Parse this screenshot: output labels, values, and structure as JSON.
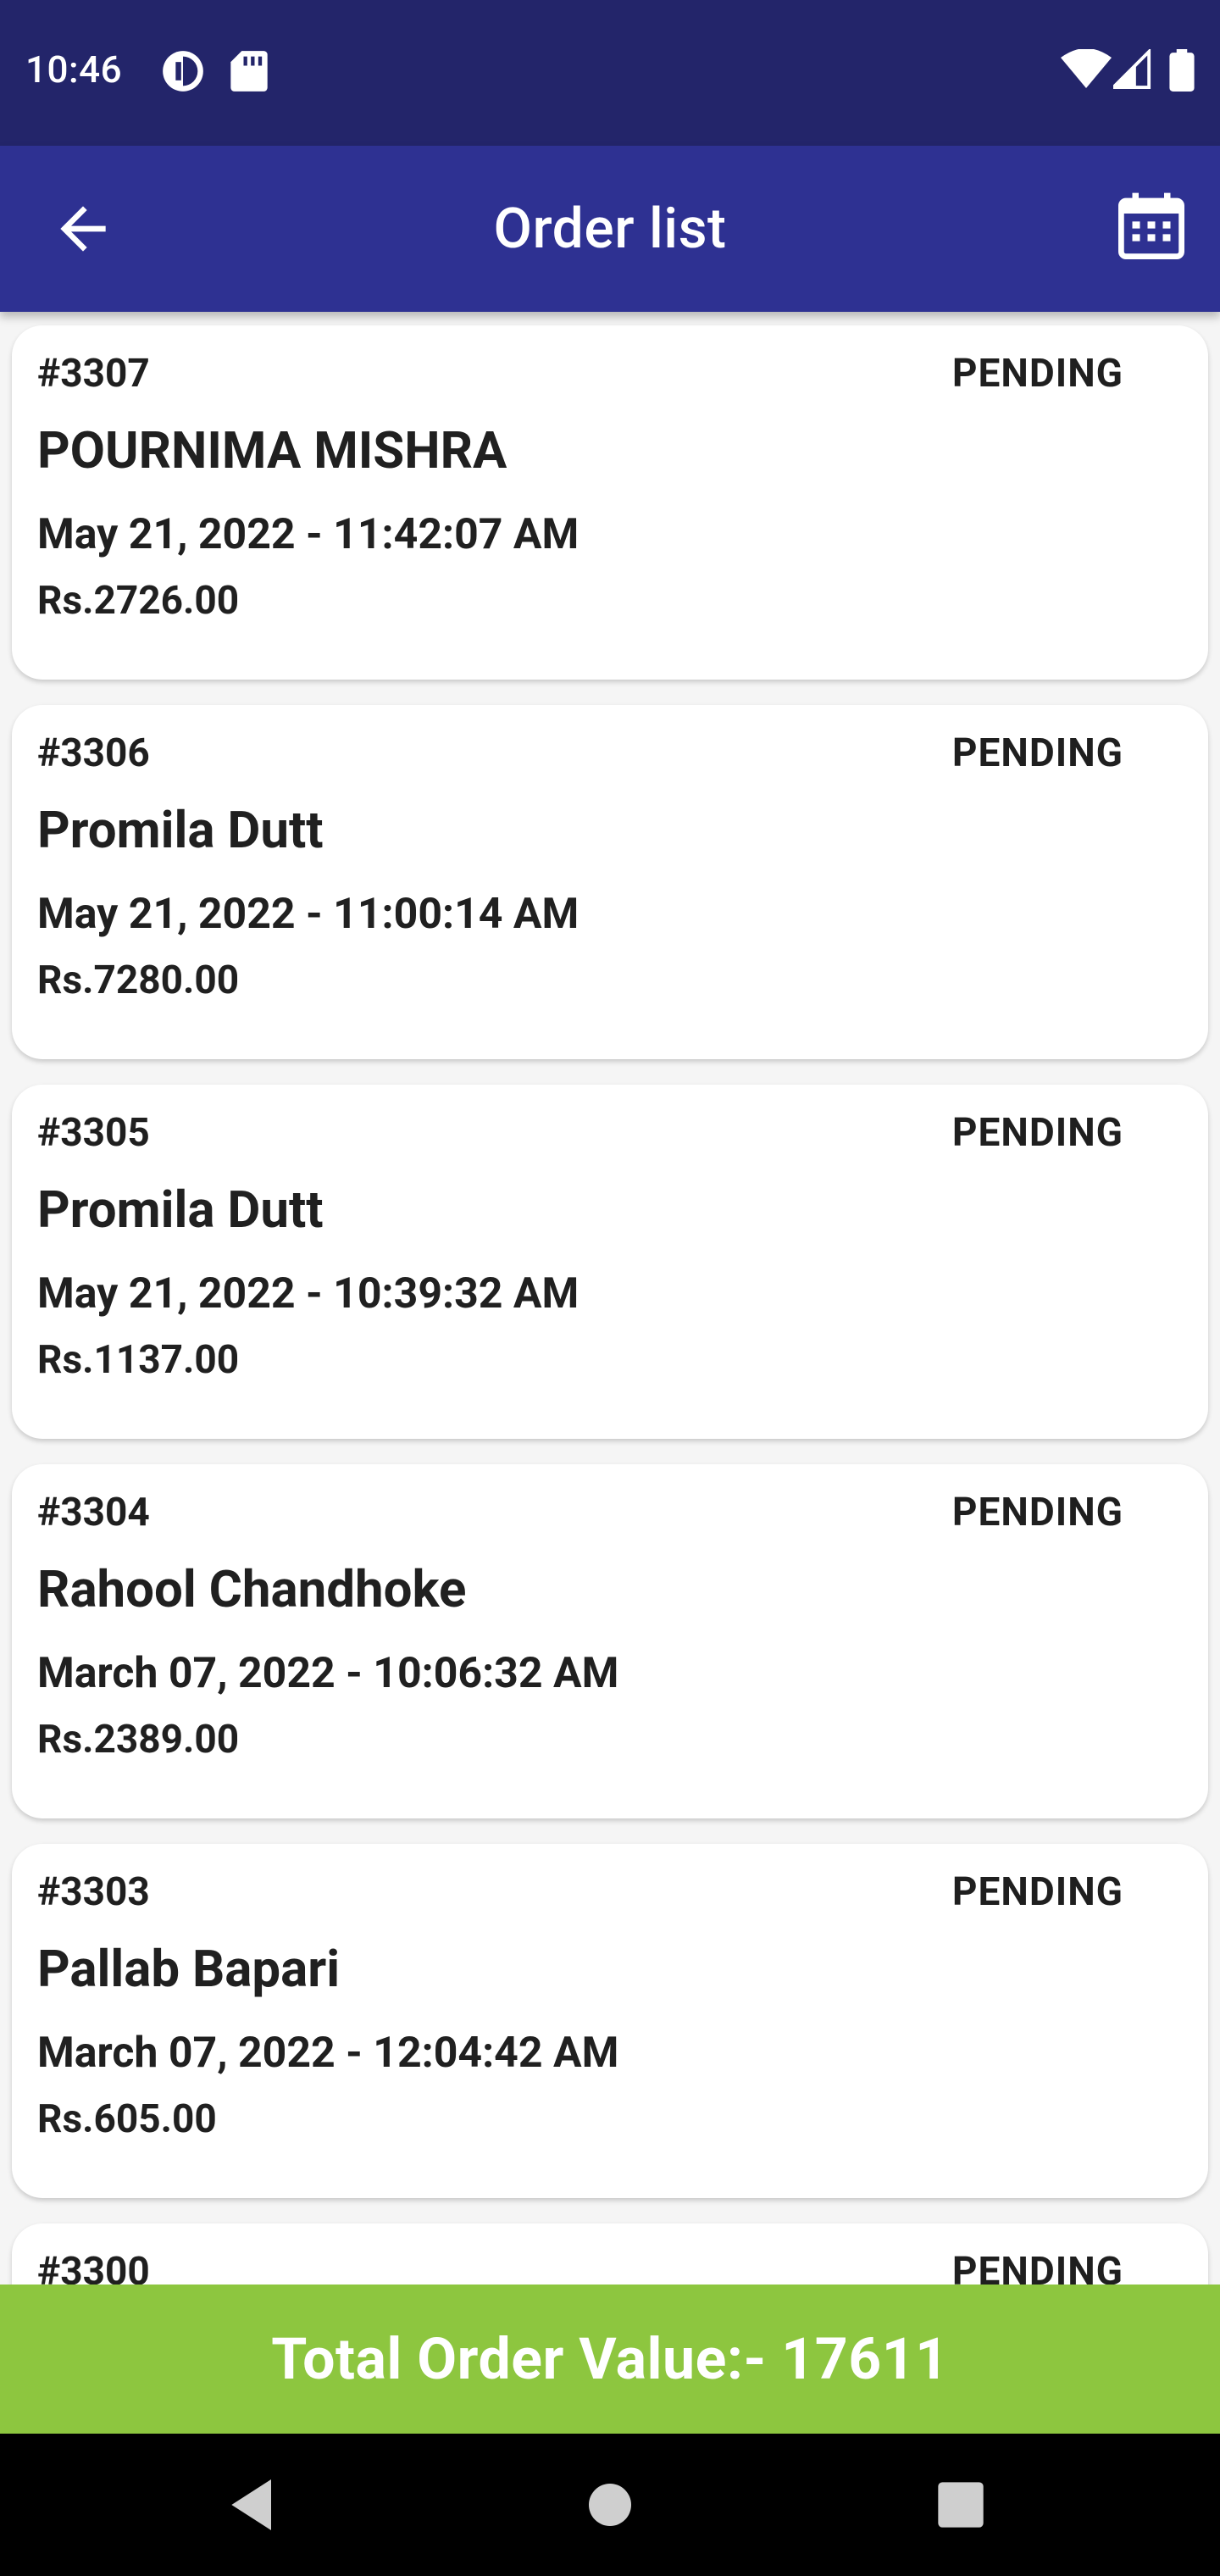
{
  "status_bar": {
    "time": "10:46",
    "left_icons": [
      "data-saver-icon",
      "sd-card-icon"
    ],
    "right_icons": [
      "wifi-icon",
      "cell-signal-icon",
      "battery-icon"
    ]
  },
  "app_bar": {
    "title": "Order list",
    "back_icon": "arrow-back-icon",
    "calendar_icon": "calendar-icon"
  },
  "orders": [
    {
      "id": "#3307",
      "status": "PENDING",
      "customer": "POURNIMA MISHRA",
      "datetime": "May 21, 2022 - 11:42:07 AM",
      "amount": "Rs.2726.00"
    },
    {
      "id": "#3306",
      "status": "PENDING",
      "customer": "Promila Dutt",
      "datetime": "May 21, 2022 - 11:00:14 AM",
      "amount": "Rs.7280.00"
    },
    {
      "id": "#3305",
      "status": "PENDING",
      "customer": "Promila Dutt",
      "datetime": "May 21, 2022 - 10:39:32 AM",
      "amount": "Rs.1137.00"
    },
    {
      "id": "#3304",
      "status": "PENDING",
      "customer": "Rahool Chandhoke",
      "datetime": "March 07, 2022 - 10:06:32 AM",
      "amount": "Rs.2389.00"
    },
    {
      "id": "#3303",
      "status": "PENDING",
      "customer": "Pallab Bapari",
      "datetime": "March 07, 2022 - 12:04:42 AM",
      "amount": "Rs.605.00"
    },
    {
      "id": "#3300",
      "status": "PENDING",
      "customer": "",
      "datetime": "",
      "amount": ""
    }
  ],
  "total": {
    "label": "Total Order Value:- 17611"
  },
  "colors": {
    "status_bar": "#23256a",
    "app_bar": "#2e3192",
    "total_bar": "#8dc63f",
    "nav_bar": "#000000",
    "card_bg": "#ffffff",
    "page_bg": "#f5f5f5"
  },
  "nav_bar": {
    "icons": [
      "nav-back-icon",
      "nav-home-icon",
      "nav-recents-icon"
    ]
  }
}
